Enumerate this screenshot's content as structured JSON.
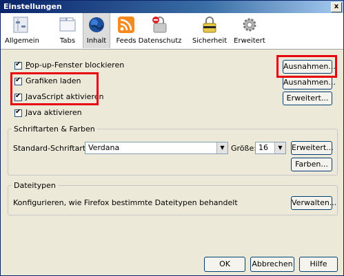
{
  "window": {
    "title": "Einstellungen",
    "close_glyph": "x"
  },
  "toolbar": [
    {
      "label": "Allgemein",
      "icon": "switch-icon"
    },
    {
      "label": "Tabs",
      "icon": "tabs-icon"
    },
    {
      "label": "Inhalt",
      "icon": "globe-icon"
    },
    {
      "label": "Feeds",
      "icon": "rss-icon"
    },
    {
      "label": "Datenschutz",
      "icon": "privacy-icon"
    },
    {
      "label": "Sicherheit",
      "icon": "lock-icon"
    },
    {
      "label": "Erweitert",
      "icon": "gear-icon"
    }
  ],
  "content": {
    "popup": {
      "label": "Pop-up-Fenster blockieren",
      "checked": true
    },
    "images": {
      "label": "Grafiken laden",
      "checked": true
    },
    "javascript": {
      "label": "JavaScript aktivieren",
      "checked": true
    },
    "java": {
      "label": "Java aktivieren",
      "checked": true
    },
    "buttons": {
      "exceptions_popup": "Ausnahmen...",
      "exceptions_images": "Ausnahmen...",
      "advanced_js": "Erweitert..."
    }
  },
  "fonts": {
    "group_label": "Schriftarten & Farben",
    "default_font_label": "Standard-Schriftart:",
    "default_font_value": "Verdana",
    "size_label": "Größe:",
    "size_value": "16",
    "advanced_button": "Erweitert...",
    "colors_button": "Farben..."
  },
  "filetypes": {
    "group_label": "Dateitypen",
    "description": "Konfigurieren, wie Firefox bestimmte Dateitypen behandelt",
    "manage_button": "Verwalten..."
  },
  "footer": {
    "ok": "OK",
    "cancel": "Abbrechen",
    "help": "Hilfe"
  },
  "colors": {
    "highlight": "#e8000b",
    "titlebar": "#0a246a"
  }
}
